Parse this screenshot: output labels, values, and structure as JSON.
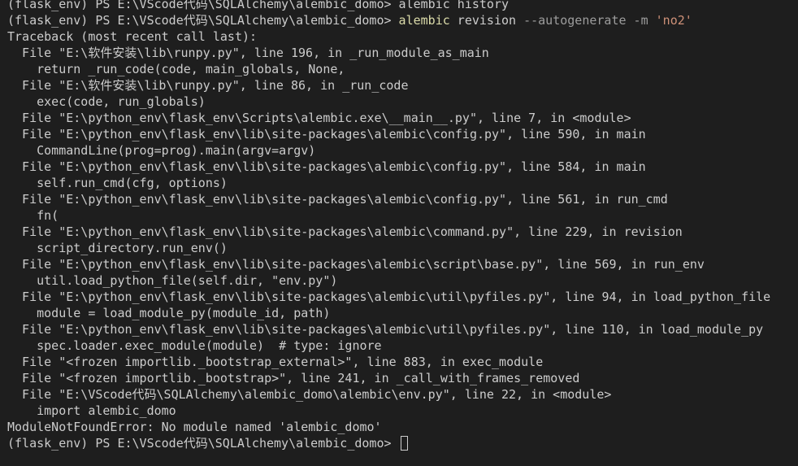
{
  "terminal": {
    "prev_line": "(flask_env) PS E:\\VScode代码\\SQLAlchemy\\alembic_domo> alembic history",
    "command_line": {
      "prompt": "(flask_env) PS E:\\VScode代码\\SQLAlchemy\\alembic_domo> ",
      "command": "alembic",
      "args": " revision ",
      "flags": "--autogenerate -m ",
      "message": "'no2'"
    },
    "traceback": [
      "Traceback (most recent call last):",
      "  File \"E:\\软件安装\\lib\\runpy.py\", line 196, in _run_module_as_main",
      "    return _run_code(code, main_globals, None,",
      "  File \"E:\\软件安装\\lib\\runpy.py\", line 86, in _run_code",
      "    exec(code, run_globals)",
      "  File \"E:\\python_env\\flask_env\\Scripts\\alembic.exe\\__main__.py\", line 7, in <module>",
      "  File \"E:\\python_env\\flask_env\\lib\\site-packages\\alembic\\config.py\", line 590, in main",
      "    CommandLine(prog=prog).main(argv=argv)",
      "  File \"E:\\python_env\\flask_env\\lib\\site-packages\\alembic\\config.py\", line 584, in main",
      "    self.run_cmd(cfg, options)",
      "  File \"E:\\python_env\\flask_env\\lib\\site-packages\\alembic\\config.py\", line 561, in run_cmd",
      "    fn(",
      "  File \"E:\\python_env\\flask_env\\lib\\site-packages\\alembic\\command.py\", line 229, in revision",
      "    script_directory.run_env()",
      "  File \"E:\\python_env\\flask_env\\lib\\site-packages\\alembic\\script\\base.py\", line 569, in run_env",
      "    util.load_python_file(self.dir, \"env.py\")",
      "  File \"E:\\python_env\\flask_env\\lib\\site-packages\\alembic\\util\\pyfiles.py\", line 94, in load_python_file",
      "    module = load_module_py(module_id, path)",
      "  File \"E:\\python_env\\flask_env\\lib\\site-packages\\alembic\\util\\pyfiles.py\", line 110, in load_module_py",
      "    spec.loader.exec_module(module)  # type: ignore",
      "  File \"<frozen importlib._bootstrap_external>\", line 883, in exec_module",
      "  File \"<frozen importlib._bootstrap>\", line 241, in _call_with_frames_removed",
      "  File \"E:\\VScode代码\\SQLAlchemy\\alembic_domo\\alembic\\env.py\", line 22, in <module>",
      "    import alembic_domo",
      "ModuleNotFoundError: No module named 'alembic_domo'"
    ],
    "final_prompt": "(flask_env) PS E:\\VScode代码\\SQLAlchemy\\alembic_domo> "
  },
  "colors": {
    "background": "#1e1e1e",
    "text": "#cccccc",
    "command": "#dcdcaa",
    "flag": "#9d9d9d",
    "string": "#ce9178"
  }
}
